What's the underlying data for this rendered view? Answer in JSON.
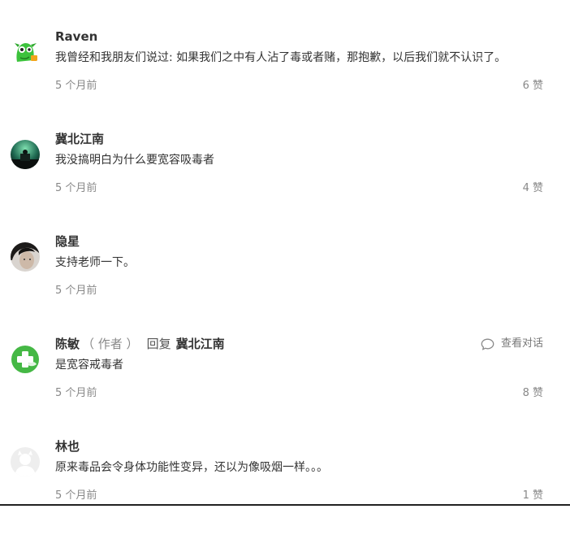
{
  "comments": [
    {
      "name": "Raven",
      "text": "我曾经和我朋友们说过: 如果我们之中有人沾了毒或者赌，那抱歉，以后我们就不认识了。",
      "time": "5 个月前",
      "likes": "6 赞",
      "avatar_icon": "green-monster-avatar"
    },
    {
      "name": "冀北江南",
      "text": "我没搞明白为什么要宽容吸毒者",
      "time": "5 个月前",
      "likes": "4 赞",
      "avatar_icon": "night-scene-avatar"
    },
    {
      "name": "隐星",
      "text": "支持老师一下。",
      "time": "5 个月前",
      "likes": "",
      "avatar_icon": "portrait-avatar"
    },
    {
      "name": "陈敏",
      "author_tag": "（ 作者 ）",
      "reply_word": "回复",
      "reply_target": "冀北江南",
      "view_thread": "查看对话",
      "text": "是宽容戒毒者",
      "time": "5 个月前",
      "likes": "8 赞",
      "avatar_icon": "green-cross-avatar"
    },
    {
      "name": "林也",
      "text": "原来毒品会令身体功能性变异，还以为像吸烟一样。。。",
      "time": "5 个月前",
      "likes": "1 赞",
      "avatar_icon": "default-user-avatar"
    }
  ],
  "colors": {
    "name": "#333333",
    "meta": "#888888",
    "accent_green": "#3cb83c"
  }
}
